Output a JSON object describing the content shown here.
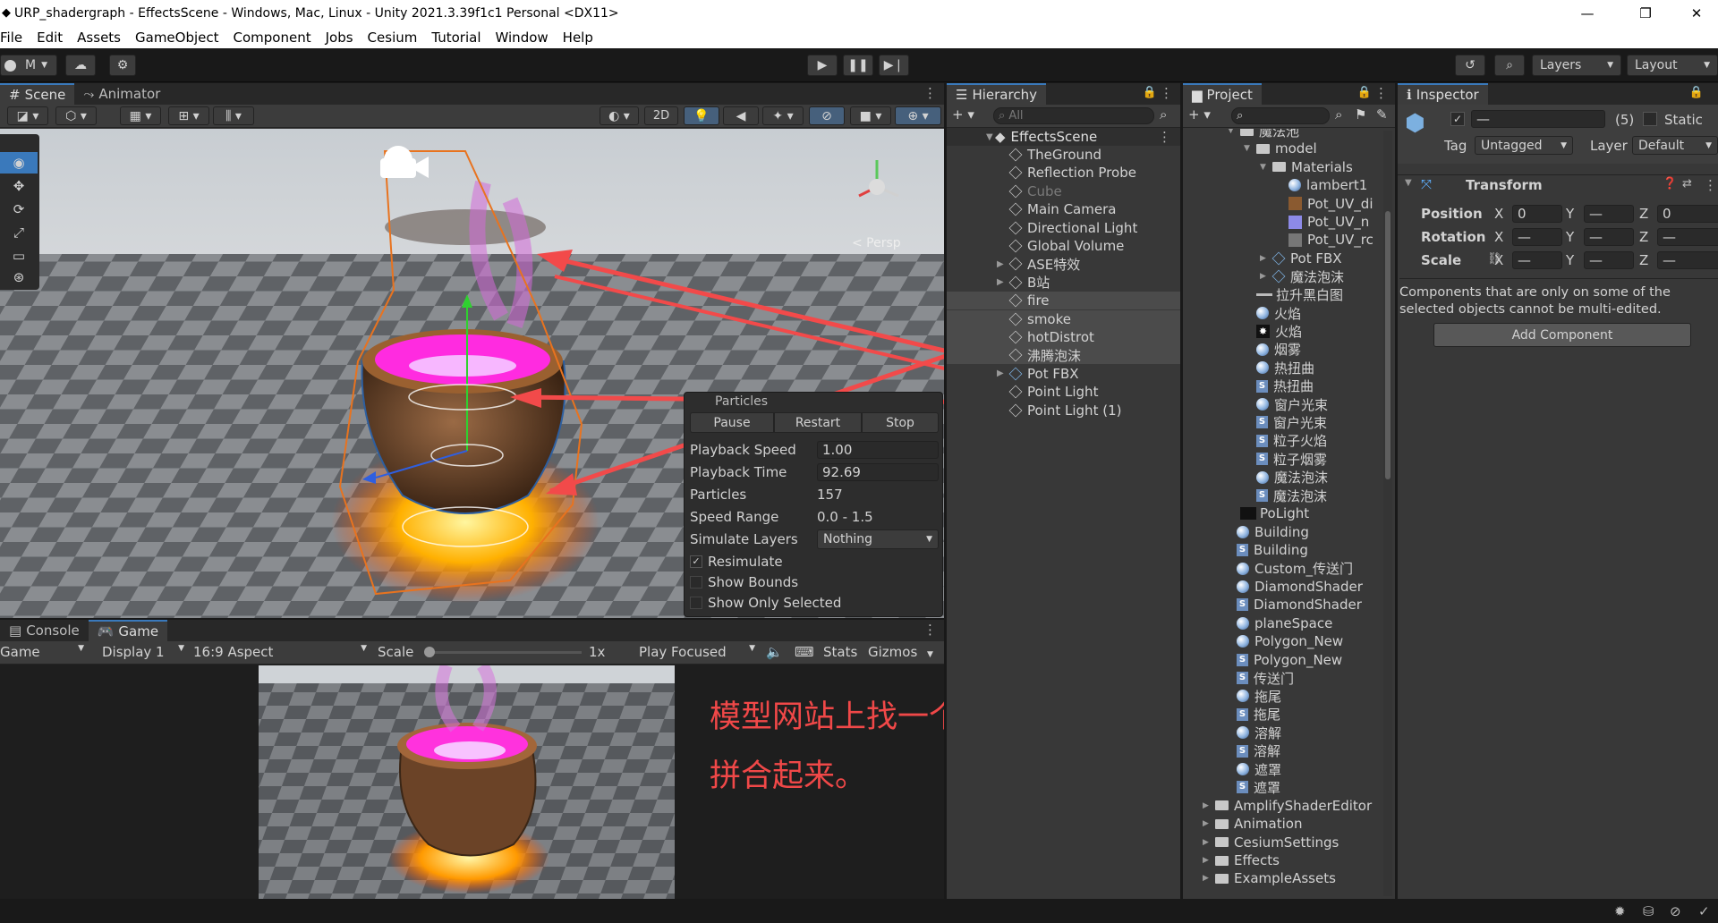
{
  "window": {
    "title": "URP_shadergraph - EffectsScene - Windows, Mac, Linux - Unity 2021.3.39f1c1 Personal <DX11>",
    "minimize": "—",
    "maximize": "❐",
    "close": "✕"
  },
  "menu": [
    "File",
    "Edit",
    "Assets",
    "GameObject",
    "Component",
    "Jobs",
    "Cesium",
    "Tutorial",
    "Window",
    "Help"
  ],
  "toolbar": {
    "account": "M",
    "layers": "Layers",
    "layout": "Layout"
  },
  "scene": {
    "tabs": [
      "Scene",
      "Animator"
    ],
    "view_mode": "2D",
    "persp_label": "< Persp",
    "particles_panel": {
      "title": "Particles",
      "buttons": [
        "Pause",
        "Restart",
        "Stop"
      ],
      "props": [
        {
          "label": "Playback Speed",
          "value": "1.00"
        },
        {
          "label": "Playback Time",
          "value": "92.69"
        },
        {
          "label": "Particles",
          "value": "157"
        },
        {
          "label": "Speed Range",
          "value": "0.0 - 1.5"
        },
        {
          "label": "Simulate Layers",
          "value": "Nothing"
        }
      ],
      "checks": [
        {
          "label": "Resimulate",
          "checked": true
        },
        {
          "label": "Show Bounds",
          "checked": false
        },
        {
          "label": "Show Only Selected",
          "checked": false
        }
      ]
    }
  },
  "game": {
    "tabs": [
      "Console",
      "Game"
    ],
    "mode": "Game",
    "display": "Display 1",
    "aspect": "16:9 Aspect",
    "scale_label": "Scale",
    "scale_value": "1x",
    "play_mode": "Play Focused",
    "stats": "Stats",
    "gizmos": "Gizmos",
    "annotation_line1": "模型网站上找一个锅模型导入",
    "annotation_line2": "拼合起来。"
  },
  "hierarchy": {
    "tab": "Hierarchy",
    "search_placeholder": "All",
    "scene_name": "EffectsScene",
    "items": [
      {
        "name": "TheGround",
        "fold": false,
        "dim": false,
        "sel": false
      },
      {
        "name": "Reflection Probe",
        "fold": false,
        "dim": false,
        "sel": false
      },
      {
        "name": "Cube",
        "fold": false,
        "dim": true,
        "sel": false
      },
      {
        "name": "Main Camera",
        "fold": false,
        "dim": false,
        "sel": false
      },
      {
        "name": "Directional Light",
        "fold": false,
        "dim": false,
        "sel": false
      },
      {
        "name": "Global Volume",
        "fold": false,
        "dim": false,
        "sel": false
      },
      {
        "name": "ASE特效",
        "fold": true,
        "dim": false,
        "sel": false
      },
      {
        "name": "B站",
        "fold": true,
        "dim": false,
        "sel": false
      },
      {
        "name": "fire",
        "fold": false,
        "dim": false,
        "sel": true
      },
      {
        "name": "smoke",
        "fold": false,
        "dim": false,
        "sel": true
      },
      {
        "name": "hotDistrot",
        "fold": false,
        "dim": false,
        "sel": true
      },
      {
        "name": "沸腾泡沫",
        "fold": false,
        "dim": false,
        "sel": true
      },
      {
        "name": "Pot FBX",
        "fold": true,
        "dim": false,
        "sel": false
      },
      {
        "name": "Point Light",
        "fold": false,
        "dim": false,
        "sel": false
      },
      {
        "name": "Point Light (1)",
        "fold": false,
        "dim": false,
        "sel": false
      }
    ]
  },
  "project": {
    "tab": "Project",
    "items": [
      {
        "name": "魔法池",
        "indent": 0,
        "icon": "folder",
        "fold": "open"
      },
      {
        "name": "model",
        "indent": 1,
        "icon": "folder",
        "fold": "open"
      },
      {
        "name": "Materials",
        "indent": 2,
        "icon": "folder",
        "fold": "open"
      },
      {
        "name": "lambert1",
        "indent": 3,
        "icon": "mat",
        "fold": ""
      },
      {
        "name": "Pot_UV_di",
        "indent": 3,
        "icon": "tex1",
        "fold": ""
      },
      {
        "name": "Pot_UV_n",
        "indent": 3,
        "icon": "tex2",
        "fold": ""
      },
      {
        "name": "Pot_UV_rc",
        "indent": 3,
        "icon": "tex3",
        "fold": ""
      },
      {
        "name": "Pot FBX",
        "indent": 2,
        "icon": "prefab",
        "fold": "closed"
      },
      {
        "name": "魔法泡沫",
        "indent": 2,
        "icon": "prefab",
        "fold": "closed"
      },
      {
        "name": "拉升黑白图",
        "indent": 1,
        "icon": "line",
        "fold": ""
      },
      {
        "name": "火焰",
        "indent": 1,
        "icon": "mat",
        "fold": ""
      },
      {
        "name": "火焰",
        "indent": 1,
        "icon": "star",
        "fold": ""
      },
      {
        "name": "烟雾",
        "indent": 1,
        "icon": "mat",
        "fold": ""
      },
      {
        "name": "热扭曲",
        "indent": 1,
        "icon": "mat",
        "fold": ""
      },
      {
        "name": "热扭曲",
        "indent": 1,
        "icon": "shader",
        "fold": ""
      },
      {
        "name": "窗户光束",
        "indent": 1,
        "icon": "mat",
        "fold": ""
      },
      {
        "name": "窗户光束",
        "indent": 1,
        "icon": "shader",
        "fold": ""
      },
      {
        "name": "粒子火焰",
        "indent": 1,
        "icon": "shader",
        "fold": ""
      },
      {
        "name": "粒子烟雾",
        "indent": 1,
        "icon": "shader",
        "fold": ""
      },
      {
        "name": "魔法泡沫",
        "indent": 1,
        "icon": "mat",
        "fold": ""
      },
      {
        "name": "魔法泡沫",
        "indent": 1,
        "icon": "shader",
        "fold": ""
      },
      {
        "name": "PoLight",
        "indent": 0,
        "icon": "dark",
        "fold": ""
      },
      {
        "name": "Building",
        "indent": -1,
        "icon": "mat",
        "fold": ""
      },
      {
        "name": "Building",
        "indent": -1,
        "icon": "shader",
        "fold": ""
      },
      {
        "name": "Custom_传送门",
        "indent": -1,
        "icon": "mat",
        "fold": ""
      },
      {
        "name": "DiamondShader",
        "indent": -1,
        "icon": "mat",
        "fold": ""
      },
      {
        "name": "DiamondShader",
        "indent": -1,
        "icon": "shader",
        "fold": ""
      },
      {
        "name": "planeSpace",
        "indent": -1,
        "icon": "mat",
        "fold": ""
      },
      {
        "name": "Polygon_New",
        "indent": -1,
        "icon": "mat",
        "fold": ""
      },
      {
        "name": "Polygon_New",
        "indent": -1,
        "icon": "shader",
        "fold": ""
      },
      {
        "name": "传送门",
        "indent": -1,
        "icon": "shader",
        "fold": ""
      },
      {
        "name": "拖尾",
        "indent": -1,
        "icon": "mat",
        "fold": ""
      },
      {
        "name": "拖尾",
        "indent": -1,
        "icon": "shader",
        "fold": ""
      },
      {
        "name": "溶解",
        "indent": -1,
        "icon": "mat",
        "fold": ""
      },
      {
        "name": "溶解",
        "indent": -1,
        "icon": "shader",
        "fold": ""
      },
      {
        "name": "遮罩",
        "indent": -1,
        "icon": "mat",
        "fold": ""
      },
      {
        "name": "遮罩",
        "indent": -1,
        "icon": "shader",
        "fold": ""
      },
      {
        "name": "AmplifyShaderEditor",
        "indent": -2,
        "icon": "folder",
        "fold": "closed"
      },
      {
        "name": "Animation",
        "indent": -2,
        "icon": "folder",
        "fold": "closed"
      },
      {
        "name": "CesiumSettings",
        "indent": -2,
        "icon": "folder",
        "fold": "closed"
      },
      {
        "name": "Effects",
        "indent": -2,
        "icon": "folder",
        "fold": "closed"
      },
      {
        "name": "ExampleAssets",
        "indent": -2,
        "icon": "folder",
        "fold": "closed"
      }
    ]
  },
  "inspector": {
    "tab": "Inspector",
    "name_value": "—",
    "count": "(5)",
    "static_label": "Static",
    "tag_label": "Tag",
    "tag_value": "Untagged",
    "layer_label": "Layer",
    "layer_value": "Default",
    "transform_title": "Transform",
    "rows": [
      {
        "label": "Position",
        "x": "0",
        "y": "—",
        "z": "0"
      },
      {
        "label": "Rotation",
        "x": "—",
        "y": "—",
        "z": "—"
      },
      {
        "label": "Scale",
        "x": "—",
        "y": "—",
        "z": "—"
      }
    ],
    "axis_x": "X",
    "axis_y": "Y",
    "axis_z": "Z",
    "multi_edit_msg": "Components that are only on some of the selected objects cannot be multi-edited.",
    "add_component": "Add Component"
  }
}
